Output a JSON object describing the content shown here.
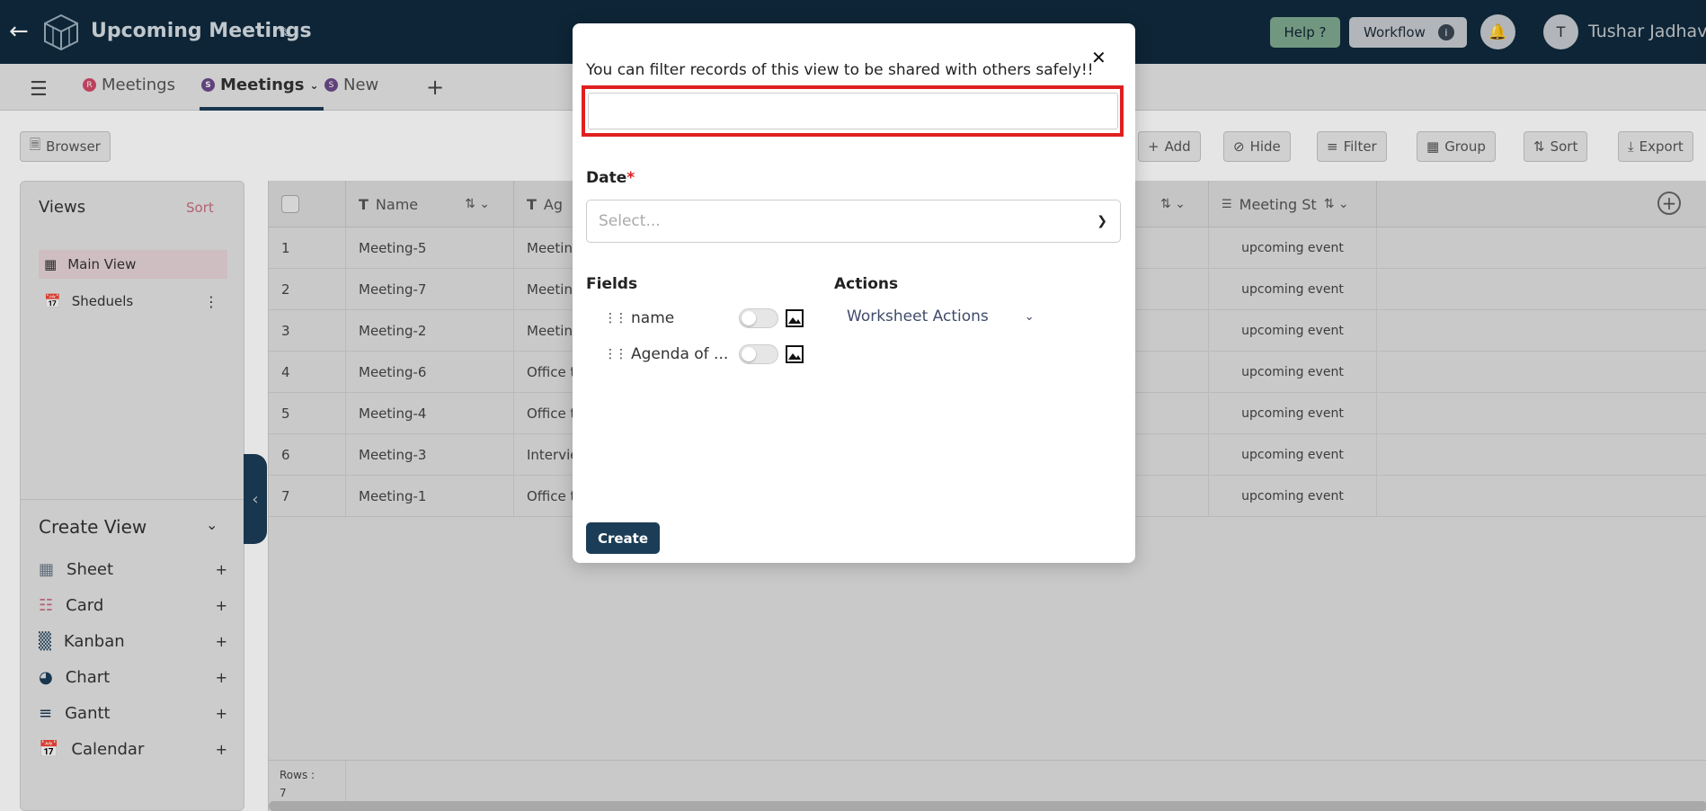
{
  "header": {
    "title": "Upcoming Meetings",
    "help_label": "Help ?",
    "workflow_label": "Workflow",
    "user_initial": "T",
    "user_name": "Tushar Jadhav"
  },
  "tabs": [
    {
      "badge": "R",
      "label": "Meetings",
      "badge_color": "#d24a6a"
    },
    {
      "badge": "S",
      "label": "Meetings",
      "badge_color": "#6b4a8a"
    },
    {
      "badge": "S",
      "label": "New",
      "badge_color": "#6b4a8a"
    }
  ],
  "toolbar": {
    "browser": "Browser",
    "add": "Add",
    "hide": "Hide",
    "filter": "Filter",
    "group": "Group",
    "sort": "Sort",
    "export": "Export"
  },
  "sidebar": {
    "views_title": "Views",
    "sort_label": "Sort",
    "views": [
      {
        "label": "Main View"
      },
      {
        "label": "Sheduels"
      }
    ],
    "create_view_title": "Create View",
    "create_items": [
      {
        "label": "Sheet"
      },
      {
        "label": "Card"
      },
      {
        "label": "Kanban"
      },
      {
        "label": "Chart"
      },
      {
        "label": "Gantt"
      },
      {
        "label": "Calendar"
      }
    ]
  },
  "grid": {
    "columns": [
      "Name",
      "Ag",
      "Meeting St"
    ],
    "rows": [
      {
        "num": "1",
        "name": "Meeting-5",
        "agenda": "Meetin",
        "status": "upcoming event"
      },
      {
        "num": "2",
        "name": "Meeting-7",
        "agenda": "Meetin",
        "status": "upcoming event"
      },
      {
        "num": "3",
        "name": "Meeting-2",
        "agenda": "Meetin",
        "status": "upcoming event"
      },
      {
        "num": "4",
        "name": "Meeting-6",
        "agenda": "Office t",
        "status": "upcoming event"
      },
      {
        "num": "5",
        "name": "Meeting-4",
        "agenda": "Office t",
        "status": "upcoming event"
      },
      {
        "num": "6",
        "name": "Meeting-3",
        "agenda": "Intervie",
        "status": "upcoming event"
      },
      {
        "num": "7",
        "name": "Meeting-1",
        "agenda": "Office t",
        "status": "upcoming event"
      }
    ],
    "rows_label": "Rows :",
    "rows_count": "7"
  },
  "modal": {
    "message": "You can filter records of this view to be shared with others safely!!",
    "input_value": "",
    "date_label": "Date",
    "date_required": "*",
    "date_placeholder": "Select...",
    "fields_label": "Fields",
    "fields": [
      {
        "name": "name"
      },
      {
        "name": "Agenda of ..."
      }
    ],
    "actions_label": "Actions",
    "worksheet_actions": "Worksheet Actions",
    "create_label": "Create"
  },
  "colors": {
    "topbar": "#0f2a3d",
    "accent": "#1b3d57",
    "highlight": "#e02020"
  }
}
